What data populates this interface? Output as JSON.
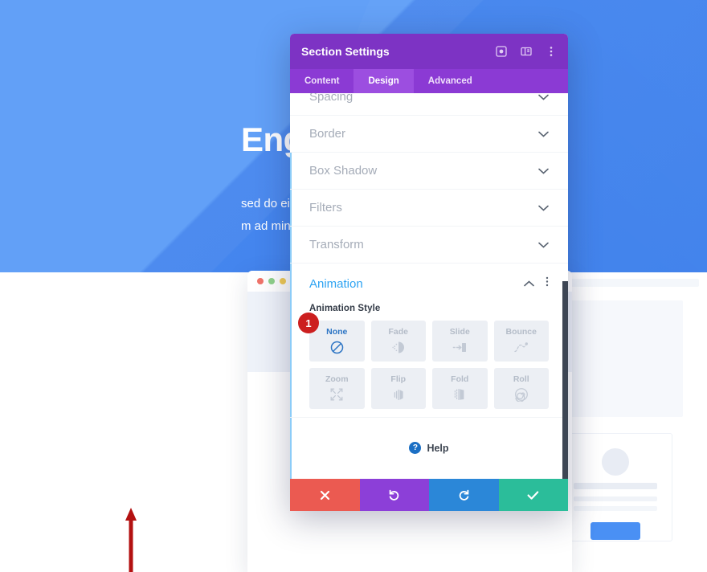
{
  "website": {
    "hero": {
      "title": "Engagement",
      "body_line1": "sed do eiusmod tempor",
      "body_line2": "m ad minim veniam,"
    },
    "cards": [
      {
        "button_label": ""
      },
      {
        "button_label": ""
      },
      {
        "button_label": ""
      }
    ]
  },
  "annotation": {
    "arrow_color": "#b31111",
    "step_badge": "1"
  },
  "modal": {
    "title": "Section Settings",
    "header_icons": [
      {
        "name": "focus-icon"
      },
      {
        "name": "layout-panel-icon"
      },
      {
        "name": "more-vertical-icon"
      }
    ],
    "tabs": [
      {
        "label": "Content",
        "active": false
      },
      {
        "label": "Design",
        "active": true
      },
      {
        "label": "Advanced",
        "active": false
      }
    ],
    "sections": [
      {
        "label": "Spacing",
        "expanded": false
      },
      {
        "label": "Border",
        "expanded": false
      },
      {
        "label": "Box Shadow",
        "expanded": false
      },
      {
        "label": "Filters",
        "expanded": false
      },
      {
        "label": "Transform",
        "expanded": false
      }
    ],
    "animation": {
      "title": "Animation",
      "expanded": true,
      "field_label": "Animation Style",
      "options": [
        {
          "label": "None",
          "icon": "no-entry-icon",
          "selected": true
        },
        {
          "label": "Fade",
          "icon": "fade-icon",
          "selected": false
        },
        {
          "label": "Slide",
          "icon": "slide-icon",
          "selected": false
        },
        {
          "label": "Bounce",
          "icon": "bounce-icon",
          "selected": false
        },
        {
          "label": "Zoom",
          "icon": "zoom-expand-icon",
          "selected": false
        },
        {
          "label": "Flip",
          "icon": "flip-icon",
          "selected": false
        },
        {
          "label": "Fold",
          "icon": "fold-icon",
          "selected": false
        },
        {
          "label": "Roll",
          "icon": "roll-spiral-icon",
          "selected": false
        }
      ]
    },
    "help": {
      "label": "Help",
      "icon": "question-mark-icon"
    },
    "footer_buttons": [
      {
        "name": "close",
        "icon": "close-x-icon",
        "color": "#eb5a51"
      },
      {
        "name": "undo",
        "icon": "undo-icon",
        "color": "#8c3fd8"
      },
      {
        "name": "redo",
        "icon": "redo-icon",
        "color": "#2b87d8"
      },
      {
        "name": "save",
        "icon": "checkmark-icon",
        "color": "#2bbd9a"
      }
    ],
    "colors": {
      "header": "#7d33c4",
      "tabbar": "#8b3ad4",
      "tab_active": "#9c4ee0",
      "accent": "#2ea3f2"
    }
  }
}
